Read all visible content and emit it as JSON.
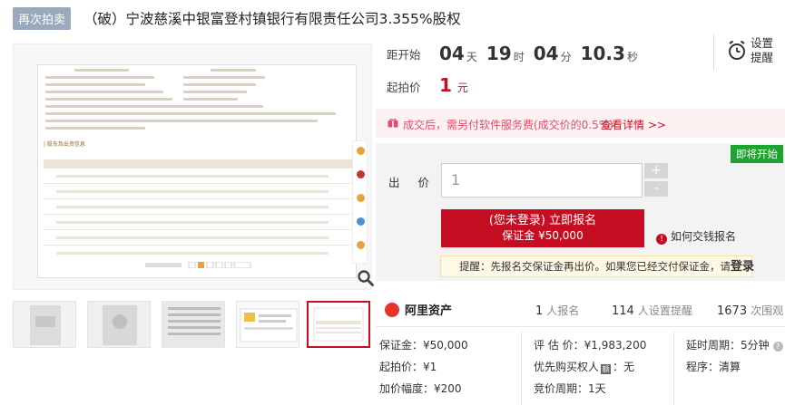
{
  "header": {
    "tag": "再次拍卖",
    "title": "（破）宁波慈溪中银富登村镇银行有限责任公司3.355%股权"
  },
  "countdown": {
    "label": "距开始",
    "days": "04",
    "days_unit": "天",
    "hours": "19",
    "hours_unit": "时",
    "minutes": "04",
    "minutes_unit": "分",
    "seconds": "10.3",
    "seconds_unit": "秒"
  },
  "reminder": {
    "line1": "设置",
    "line2": "提醒",
    "icon": "alarm-clock-icon"
  },
  "start_price": {
    "label": "起拍价",
    "value": "1",
    "unit": "元"
  },
  "fee_notice": {
    "text": "成交后，需另付软件服务费(成交价的0.5%)",
    "link": "查看详情 >>"
  },
  "bid_panel": {
    "badge": "即将开始",
    "label": "出 价",
    "input_value": "1",
    "plus": "+",
    "minus": "-",
    "signup_line1": "(您未登录) 立即报名",
    "signup_line2": "保证金 ¥50,000",
    "howto": "如何交钱报名",
    "notice_prefix": "提醒：先报名交保证金再出价。如果您已经交付保证金，请",
    "notice_link": "登录"
  },
  "preview": {
    "section_title": "| 股东及出资信息",
    "zoom_icon": "magnifier-icon"
  },
  "platform": {
    "name": "阿里资产",
    "signups": "1",
    "signups_label": "人报名",
    "reminders": "114",
    "reminders_label": "人设置提醒",
    "views": "1673",
    "views_label": "次围观"
  },
  "details": {
    "deposit": "保证金：¥50,000",
    "start": "起拍价：¥1",
    "increment": "加价幅度：¥200",
    "valuation": "评 估 价：¥1,983,200",
    "priority_label": "优先购买权人",
    "priority_badge": "额",
    "priority_value": "：无",
    "period": "竞价周期：1天",
    "delay": "延时周期：5分钟",
    "procedure": "程序：清算"
  }
}
